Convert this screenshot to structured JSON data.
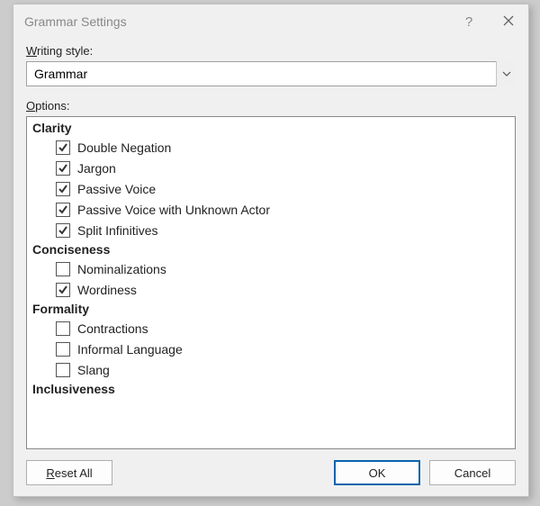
{
  "dialog": {
    "title": "Grammar Settings",
    "help_icon": "?",
    "close_icon": "✕"
  },
  "writing_style": {
    "label_prefix": "W",
    "label_rest": "riting style:",
    "value": "Grammar"
  },
  "options_label_prefix": "O",
  "options_label_rest": "ptions:",
  "groups": [
    {
      "header": "Clarity",
      "items": [
        {
          "label": "Double Negation",
          "checked": true
        },
        {
          "label": "Jargon",
          "checked": true
        },
        {
          "label": "Passive Voice",
          "checked": true
        },
        {
          "label": "Passive Voice with Unknown Actor",
          "checked": true
        },
        {
          "label": "Split Infinitives",
          "checked": true
        }
      ]
    },
    {
      "header": "Conciseness",
      "items": [
        {
          "label": "Nominalizations",
          "checked": false
        },
        {
          "label": "Wordiness",
          "checked": true
        }
      ]
    },
    {
      "header": "Formality",
      "items": [
        {
          "label": "Contractions",
          "checked": false
        },
        {
          "label": "Informal Language",
          "checked": false
        },
        {
          "label": "Slang",
          "checked": false
        }
      ]
    },
    {
      "header": "Inclusiveness",
      "items": []
    }
  ],
  "buttons": {
    "reset_prefix": "R",
    "reset_rest": "eset All",
    "ok": "OK",
    "cancel": "Cancel"
  }
}
